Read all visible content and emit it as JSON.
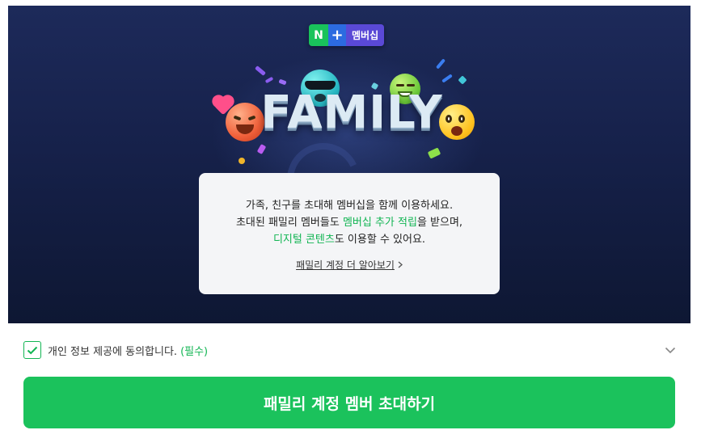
{
  "banner": {
    "badge": {
      "n": "N",
      "plus": "+",
      "label": "멤버십"
    },
    "title": "FAMILY",
    "card": {
      "line1": "가족, 친구를 초대해 멤버십을 함께 이용하세요.",
      "line2_pre": "초대된 패밀리 멤버들도 ",
      "line2_highlight": "멤버십 추가 적립",
      "line2_post": "을 받으며,",
      "line3_highlight": "디지털 콘텐츠",
      "line3_post": "도 이용할 수 있어요.",
      "link": "패밀리 계정 더 알아보기"
    }
  },
  "consent": {
    "checked": true,
    "text": "개인 정보 제공에 동의합니다.",
    "required": "(필수)",
    "expand_icon": "chevron-down-icon"
  },
  "cta": {
    "label": "패밀리 계정 멤버 초대하기"
  },
  "colors": {
    "accent_green": "#1bc25c",
    "banner_bg": "#16214a",
    "card_bg": "#f4f5f7"
  }
}
